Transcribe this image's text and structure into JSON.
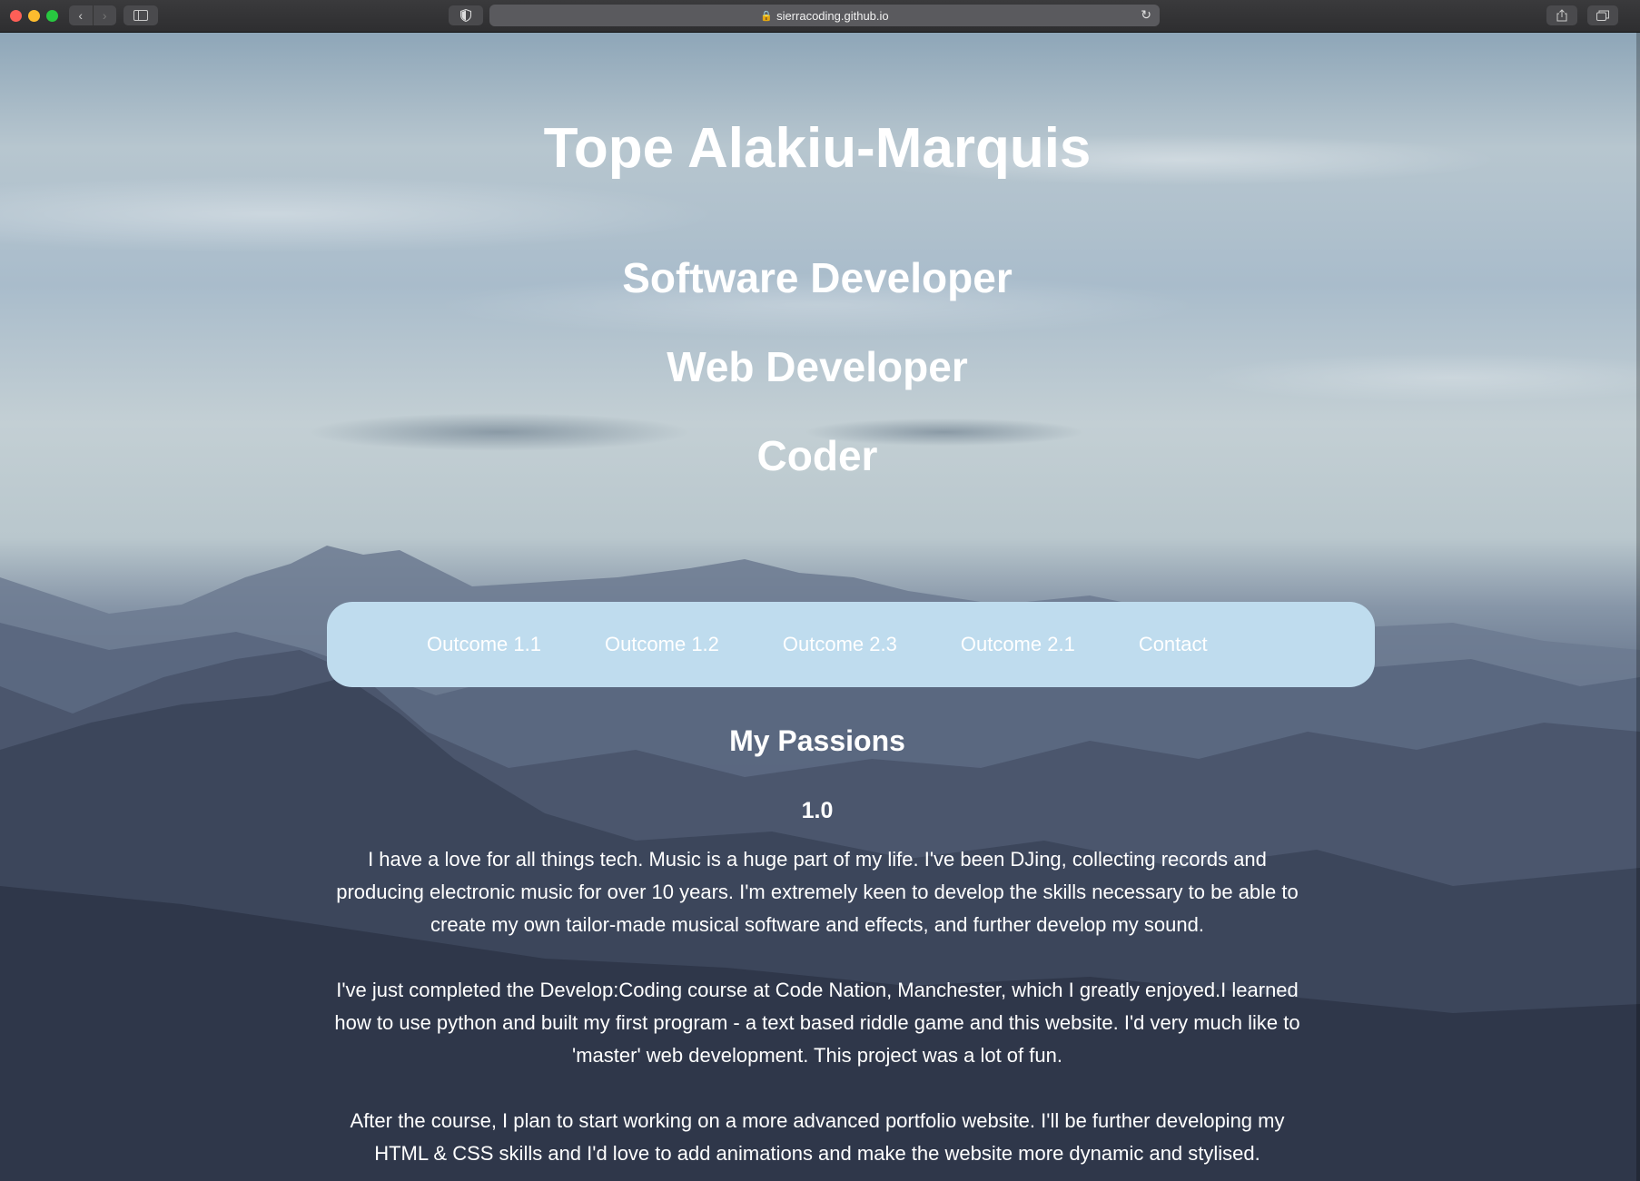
{
  "browser": {
    "url": "sierracoding.github.io",
    "back_icon": "chevron-left-icon",
    "forward_icon": "chevron-right-icon",
    "reload_icon": "reload-icon"
  },
  "header": {
    "name": "Tope Alakiu-Marquis",
    "roles": [
      "Software Developer",
      "Web Developer",
      "Coder"
    ]
  },
  "nav": {
    "items": [
      "Outcome 1.1",
      "Outcome 1.2",
      "Outcome 2.3",
      "Outcome 2.1",
      "Contact"
    ],
    "background": "#bfdcee"
  },
  "main": {
    "heading": "My Passions",
    "version": "1.0",
    "paragraphs": [
      "I have a love for all things tech. Music is a huge part of my life. I've been DJing, collecting records and producing electronic music for over 10 years. I'm extremely keen to develop the skills necessary to be able to create my own tailor-made musical software and effects, and further develop my sound.",
      "I've just completed the Develop:Coding course at Code Nation, Manchester, which I greatly enjoyed.I learned how to use python and built my first program - a text based riddle game and this website. I'd very much like to 'master' web development. This project was a lot of fun.",
      "After the course, I plan to start working on a more advanced portfolio website. I'll be further developing my HTML & CSS skills and I'd love to add animations and make the website more dynamic and stylised."
    ]
  }
}
